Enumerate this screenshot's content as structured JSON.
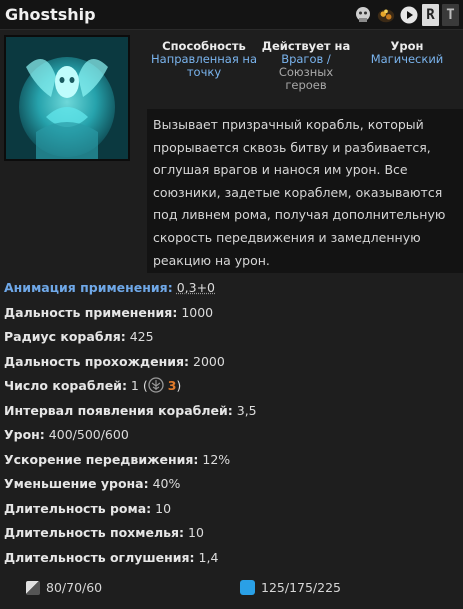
{
  "header": {
    "title": "Ghostship",
    "key_primary": "R",
    "key_secondary": "T"
  },
  "properties": {
    "ability": {
      "label": "Способность",
      "value": "Направленная на точку"
    },
    "affects": {
      "label": "Действует на",
      "value_main": "Врагов /",
      "value_secondary": "Союзных героев"
    },
    "damage": {
      "label": "Урон",
      "value": "Магический"
    }
  },
  "description": "Вызывает призрачный корабль, который прорывается сквозь битву и разбивается, оглушая врагов и нанося им урон. Все союзники, задетые кораблем, оказываются под ливнем рома, получая дополнительную скорость передвижения и замедленную реакцию на урон.",
  "stats": [
    {
      "key": "Анимация применения:",
      "value": "0,3+0",
      "link": true
    },
    {
      "key": "Дальность применения:",
      "value": "1000"
    },
    {
      "key": "Радиус корабля:",
      "value": "425"
    },
    {
      "key": "Дальность прохождения:",
      "value": "2000"
    },
    {
      "key": "Число кораблей:",
      "value": "1 (",
      "scepter_value": "3",
      "suffix": ")"
    },
    {
      "key": "Интервал появления кораблей:",
      "value": "3,5"
    },
    {
      "key": "Урон:",
      "value": "400/500/600"
    },
    {
      "key": "Ускорение передвижения:",
      "value": "12%"
    },
    {
      "key": "Уменьшение урона:",
      "value": "40%"
    },
    {
      "key": "Длительность рома:",
      "value": "10"
    },
    {
      "key": "Длительность похмелья:",
      "value": "10"
    },
    {
      "key": "Длительность оглушения:",
      "value": "1,4"
    }
  ],
  "footer": {
    "cooldown": "80/70/60",
    "mana": "125/175/225"
  },
  "colors": {
    "link": "#6fa8e8",
    "scepter": "#e07a2a",
    "mana": "#2aa0e6"
  }
}
